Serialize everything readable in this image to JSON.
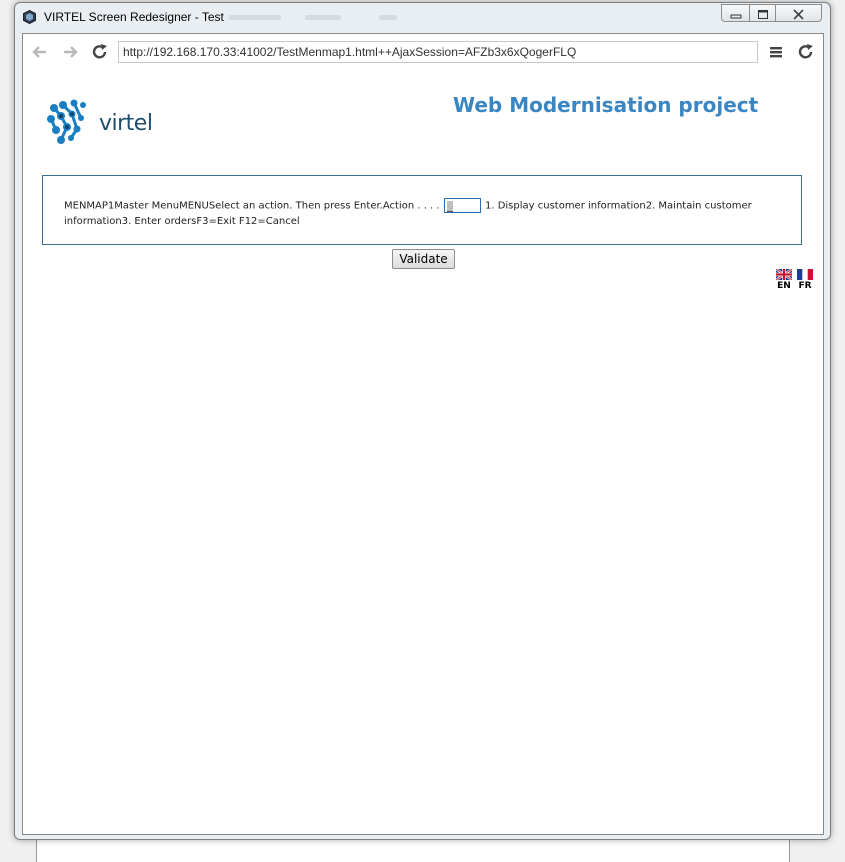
{
  "window": {
    "title": "VIRTEL Screen Redesigner - Test",
    "controls": {
      "minimize": "▭",
      "maximize": "▢",
      "close": "✕"
    }
  },
  "browser": {
    "url": "http://192.168.170.33:41002/TestMenmap1.html++AjaxSession=AFZb3x6xQogerFLQ",
    "icons": [
      "back-arrow-icon",
      "forward-arrow-icon",
      "reload-icon",
      "menu-icon",
      "reload-icon"
    ]
  },
  "page": {
    "logo_text": "virtel",
    "heading": "Web Modernisation project",
    "screen": {
      "text_before": "MENMAP1Master MenuMENUSelect an action. Then press Enter.Action . . . .",
      "action_value": "",
      "text_after": "1. Display customer information2. Maintain customer information3. Enter ordersF3=Exit F12=Cancel"
    },
    "validate_label": "Validate",
    "languages": [
      {
        "code": "EN",
        "flag": "uk-flag-icon"
      },
      {
        "code": "FR",
        "flag": "france-flag-icon"
      }
    ]
  },
  "colors": {
    "heading": "#3a86c2",
    "panel_border": "#3c6f8f",
    "logo_blue": "#1a7fc1"
  }
}
